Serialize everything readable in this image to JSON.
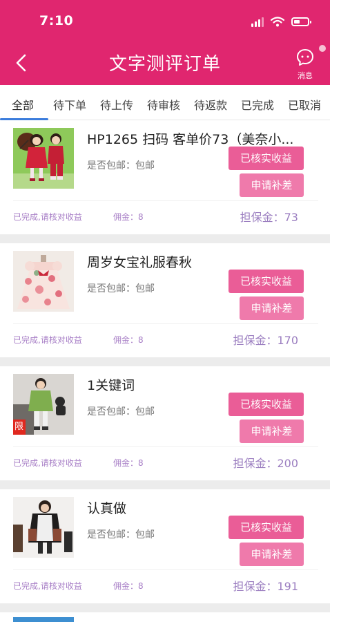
{
  "status_bar": {
    "time": "7:10"
  },
  "header": {
    "title": "文字测评订单",
    "message_label": "消息"
  },
  "tabs": [
    {
      "label": "全部",
      "active": true
    },
    {
      "label": "待下单"
    },
    {
      "label": "待上传"
    },
    {
      "label": "待审核"
    },
    {
      "label": "待返款"
    },
    {
      "label": "已完成"
    },
    {
      "label": "已取消"
    }
  ],
  "orders": [
    {
      "title": "HP1265 扫码 客单价73（美奈小...",
      "shipping": "是否包邮：包邮",
      "verified_label": "已核实收益",
      "apply_label": "申请补差",
      "status": "已完成,请核对收益",
      "commission": "佣金：8",
      "deposit": "担保金：73"
    },
    {
      "title": "周岁女宝礼服春秋",
      "shipping": "是否包邮：包邮",
      "verified_label": "已核实收益",
      "apply_label": "申请补差",
      "status": "已完成,请核对收益",
      "commission": "佣金：8",
      "deposit": "担保金：170"
    },
    {
      "title": "1关键词",
      "shipping": "是否包邮：包邮",
      "verified_label": "已核实收益",
      "apply_label": "申请补差",
      "status": "已完成,请核对收益",
      "commission": "佣金：8",
      "deposit": "担保金：200",
      "thumb_badge": "限"
    },
    {
      "title": "认真做",
      "shipping": "是否包邮：包邮",
      "verified_label": "已核实收益",
      "apply_label": "申请补差",
      "status": "已完成,请核对收益",
      "commission": "佣金：8",
      "deposit": "担保金：191"
    }
  ],
  "colors": {
    "brand": "#e0266f",
    "button_primary": "#ea5d97",
    "button_secondary": "#ef7aab",
    "tab_indicator": "#3b7cdc",
    "status_text": "#a77ec6"
  }
}
